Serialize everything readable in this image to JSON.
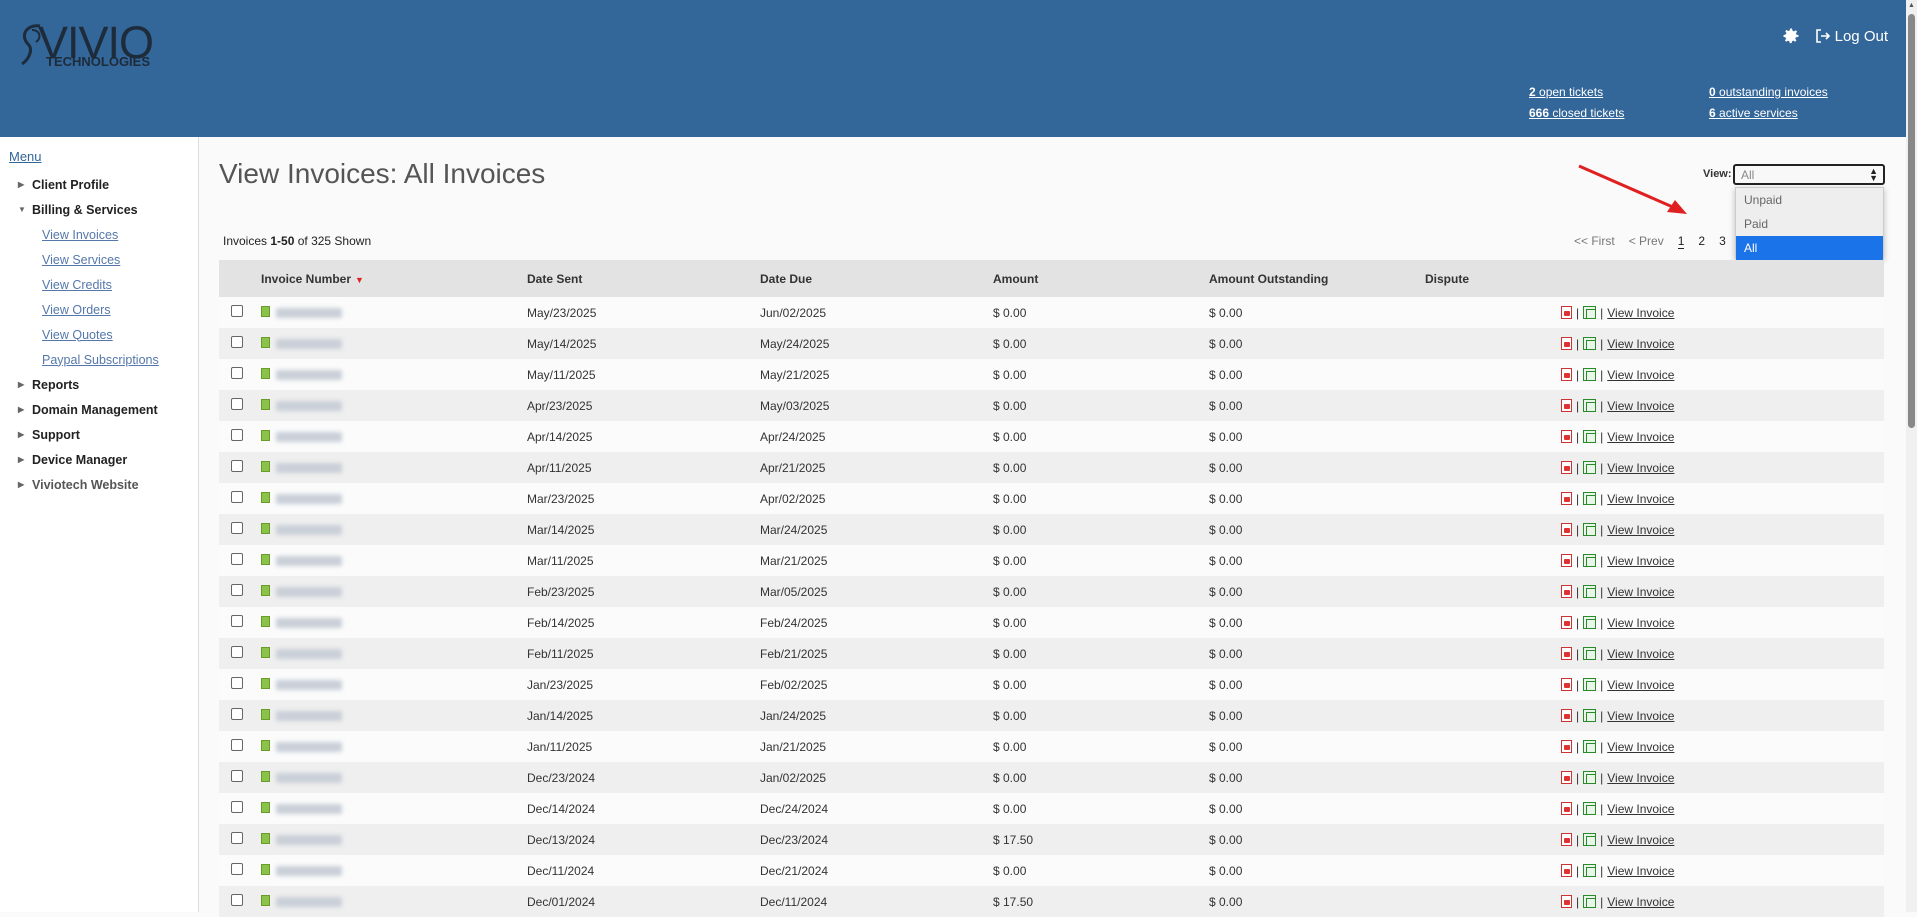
{
  "header": {
    "logo_word": "VIVIO",
    "logo_sub": "TECHNOLOGIES",
    "logout_label": "Log Out",
    "stats": {
      "open_tickets_count": "2",
      "open_tickets_label": "open tickets",
      "closed_tickets_count": "666",
      "closed_tickets_label": "closed tickets",
      "outstanding_invoices_count": "0",
      "outstanding_invoices_label": "outstanding invoices",
      "active_services_count": "6",
      "active_services_label": "active services"
    }
  },
  "sidebar": {
    "menu_title": "Menu",
    "items": [
      {
        "label": "Client Profile",
        "expanded": false
      },
      {
        "label": "Billing & Services",
        "expanded": true
      },
      {
        "label": "Reports",
        "expanded": false
      },
      {
        "label": "Domain Management",
        "expanded": false
      },
      {
        "label": "Support",
        "expanded": false
      },
      {
        "label": "Device Manager",
        "expanded": false
      },
      {
        "label": "Viviotech Website",
        "expanded": false
      }
    ],
    "billing_subitems": [
      "View Invoices",
      "View Services",
      "View Credits",
      "View Orders",
      "View Quotes",
      "Paypal Subscriptions"
    ]
  },
  "main": {
    "title": "View Invoices: All Invoices",
    "view_label": "View:",
    "view_selected": "All",
    "view_options": [
      "Unpaid",
      "Paid",
      "All"
    ],
    "showing_prefix": "Invoices ",
    "showing_range": "1-50",
    "showing_suffix": " of 325 Shown",
    "pager": {
      "first": "<< First",
      "prev": "< Prev",
      "pages": [
        "1",
        "2",
        "3"
      ]
    },
    "columns": {
      "invoice_number": "Invoice Number",
      "date_sent": "Date Sent",
      "date_due": "Date Due",
      "amount": "Amount",
      "amount_outstanding": "Amount Outstanding",
      "dispute": "Dispute"
    },
    "view_invoice_label": "View Invoice",
    "separator": "|",
    "rows": [
      {
        "sent": "May/23/2025",
        "due": "Jun/02/2025",
        "amount": "$ 0.00",
        "outstanding": "$ 0.00"
      },
      {
        "sent": "May/14/2025",
        "due": "May/24/2025",
        "amount": "$ 0.00",
        "outstanding": "$ 0.00"
      },
      {
        "sent": "May/11/2025",
        "due": "May/21/2025",
        "amount": "$ 0.00",
        "outstanding": "$ 0.00"
      },
      {
        "sent": "Apr/23/2025",
        "due": "May/03/2025",
        "amount": "$ 0.00",
        "outstanding": "$ 0.00"
      },
      {
        "sent": "Apr/14/2025",
        "due": "Apr/24/2025",
        "amount": "$ 0.00",
        "outstanding": "$ 0.00"
      },
      {
        "sent": "Apr/11/2025",
        "due": "Apr/21/2025",
        "amount": "$ 0.00",
        "outstanding": "$ 0.00"
      },
      {
        "sent": "Mar/23/2025",
        "due": "Apr/02/2025",
        "amount": "$ 0.00",
        "outstanding": "$ 0.00"
      },
      {
        "sent": "Mar/14/2025",
        "due": "Mar/24/2025",
        "amount": "$ 0.00",
        "outstanding": "$ 0.00"
      },
      {
        "sent": "Mar/11/2025",
        "due": "Mar/21/2025",
        "amount": "$ 0.00",
        "outstanding": "$ 0.00"
      },
      {
        "sent": "Feb/23/2025",
        "due": "Mar/05/2025",
        "amount": "$ 0.00",
        "outstanding": "$ 0.00"
      },
      {
        "sent": "Feb/14/2025",
        "due": "Feb/24/2025",
        "amount": "$ 0.00",
        "outstanding": "$ 0.00"
      },
      {
        "sent": "Feb/11/2025",
        "due": "Feb/21/2025",
        "amount": "$ 0.00",
        "outstanding": "$ 0.00"
      },
      {
        "sent": "Jan/23/2025",
        "due": "Feb/02/2025",
        "amount": "$ 0.00",
        "outstanding": "$ 0.00"
      },
      {
        "sent": "Jan/14/2025",
        "due": "Jan/24/2025",
        "amount": "$ 0.00",
        "outstanding": "$ 0.00"
      },
      {
        "sent": "Jan/11/2025",
        "due": "Jan/21/2025",
        "amount": "$ 0.00",
        "outstanding": "$ 0.00"
      },
      {
        "sent": "Dec/23/2024",
        "due": "Jan/02/2025",
        "amount": "$ 0.00",
        "outstanding": "$ 0.00"
      },
      {
        "sent": "Dec/14/2024",
        "due": "Dec/24/2024",
        "amount": "$ 0.00",
        "outstanding": "$ 0.00"
      },
      {
        "sent": "Dec/13/2024",
        "due": "Dec/23/2024",
        "amount": "$ 17.50",
        "outstanding": "$ 0.00"
      },
      {
        "sent": "Dec/11/2024",
        "due": "Dec/21/2024",
        "amount": "$ 0.00",
        "outstanding": "$ 0.00"
      },
      {
        "sent": "Dec/01/2024",
        "due": "Dec/11/2024",
        "amount": "$ 17.50",
        "outstanding": "$ 0.00"
      }
    ]
  },
  "colors": {
    "header_bg": "#336699",
    "link": "#5577aa",
    "selected_option": "#1a73e8",
    "annotation_arrow": "#e02020"
  },
  "icons": {
    "settings": "gear-icon",
    "logout": "logout-icon",
    "invoice_row": "invoice-doc-icon",
    "pdf": "pdf-icon",
    "excel": "excel-icon"
  }
}
